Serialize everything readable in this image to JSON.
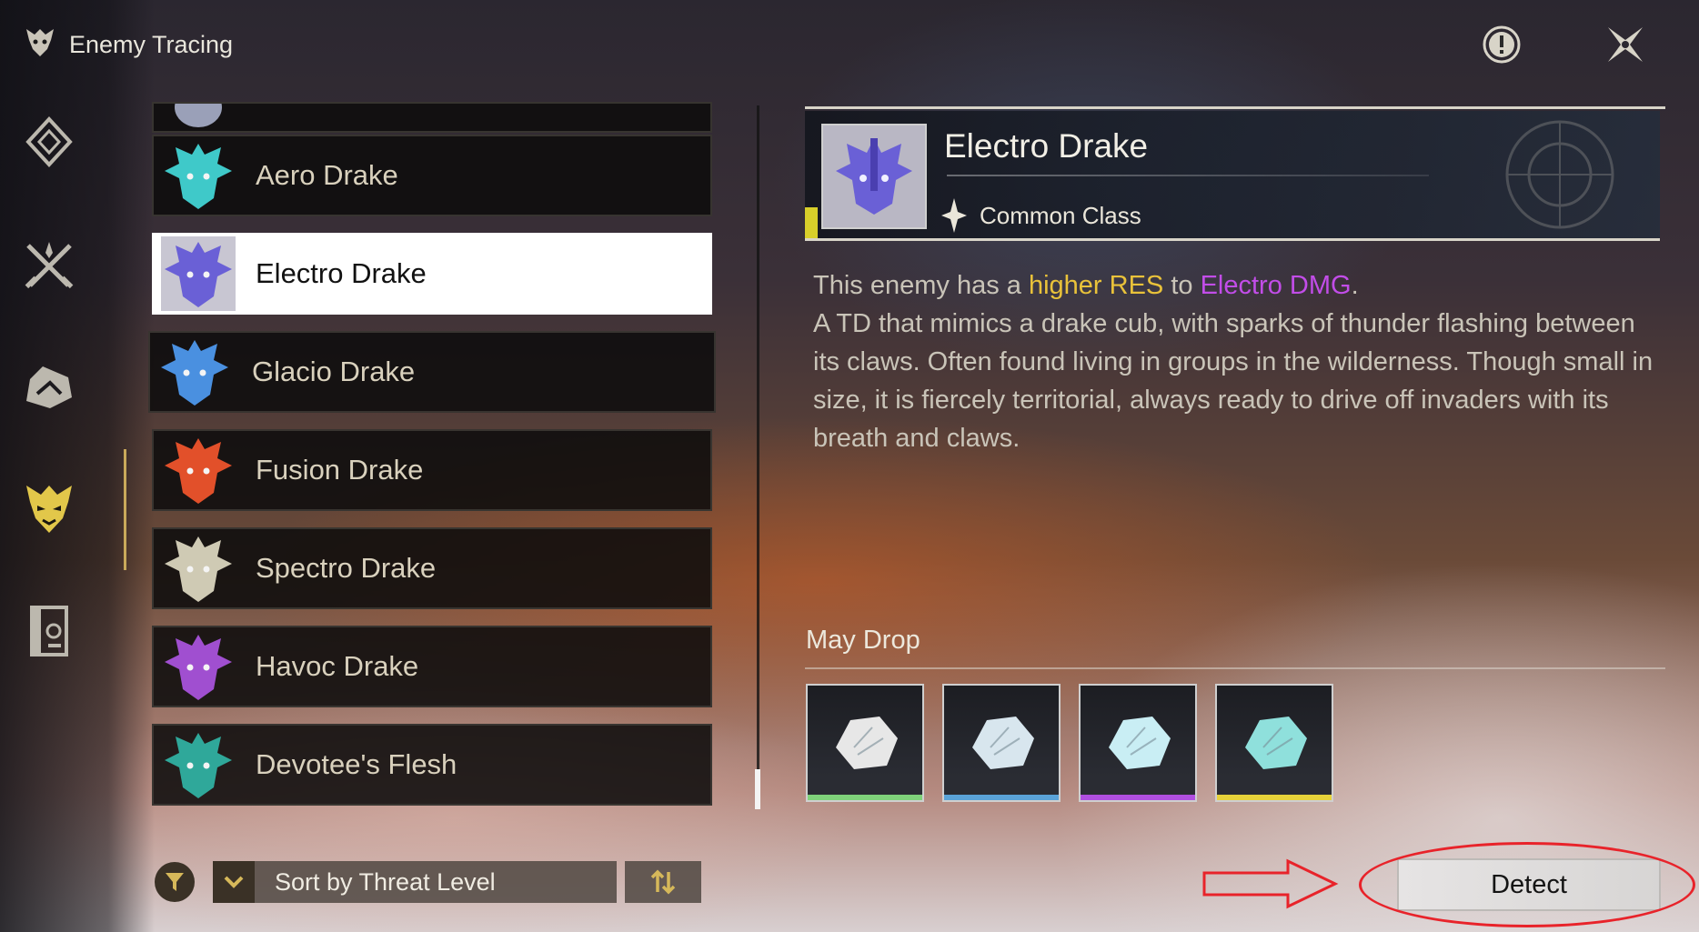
{
  "header": {
    "title": "Enemy Tracing"
  },
  "top_actions": {
    "info_icon": "info-icon",
    "close_icon": "close-icon"
  },
  "sidebar": {
    "items": [
      {
        "id": "diamond",
        "icon": "diamond-icon"
      },
      {
        "id": "swords",
        "icon": "crossed-swords-icon"
      },
      {
        "id": "gem",
        "icon": "gem-icon"
      },
      {
        "id": "enemy",
        "icon": "demon-mask-icon",
        "active": true
      },
      {
        "id": "book",
        "icon": "book-icon"
      }
    ]
  },
  "enemy_list": {
    "items": [
      {
        "name": "",
        "color": "#9aa0b8",
        "partial": true
      },
      {
        "name": "Aero Drake",
        "color": "#3fc9c9"
      },
      {
        "name": "Electro Drake",
        "color": "#6a60d6",
        "selected": true
      },
      {
        "name": "Glacio Drake",
        "color": "#4a90e0"
      },
      {
        "name": "Fusion Drake",
        "color": "#e2502a"
      },
      {
        "name": "Spectro Drake",
        "color": "#cfcab4"
      },
      {
        "name": "Havoc Drake",
        "color": "#a04fd0"
      },
      {
        "name": "Devotee's Flesh",
        "color": "#2fa89a"
      }
    ]
  },
  "detail": {
    "name": "Electro Drake",
    "class": "Common Class",
    "description": {
      "prefix": "This enemy has a ",
      "res_highlight": "higher RES",
      "middle": " to ",
      "element_highlight": "Electro DMG",
      "suffix": ".",
      "body": "A TD that mimics a drake cub, with sparks of thunder flashing between its claws. Often found living in groups in the wilderness. Though small in size, it is fiercely territorial, always ready to drive off invaders with its breath and claws."
    },
    "drops_title": "May Drop",
    "drops": [
      {
        "rarity_color": "#7fd27a"
      },
      {
        "rarity_color": "#5aa3d8"
      },
      {
        "rarity_color": "#b04fe0"
      },
      {
        "rarity_color": "#e6d23a"
      }
    ]
  },
  "bottom": {
    "sort_label": "Sort by Threat Level",
    "detect_label": "Detect"
  },
  "colors": {
    "accent": "#c9a95a",
    "highlight_yellow": "#e9c23a",
    "highlight_purple": "#c24de8",
    "annotation_red": "#e8232a"
  }
}
